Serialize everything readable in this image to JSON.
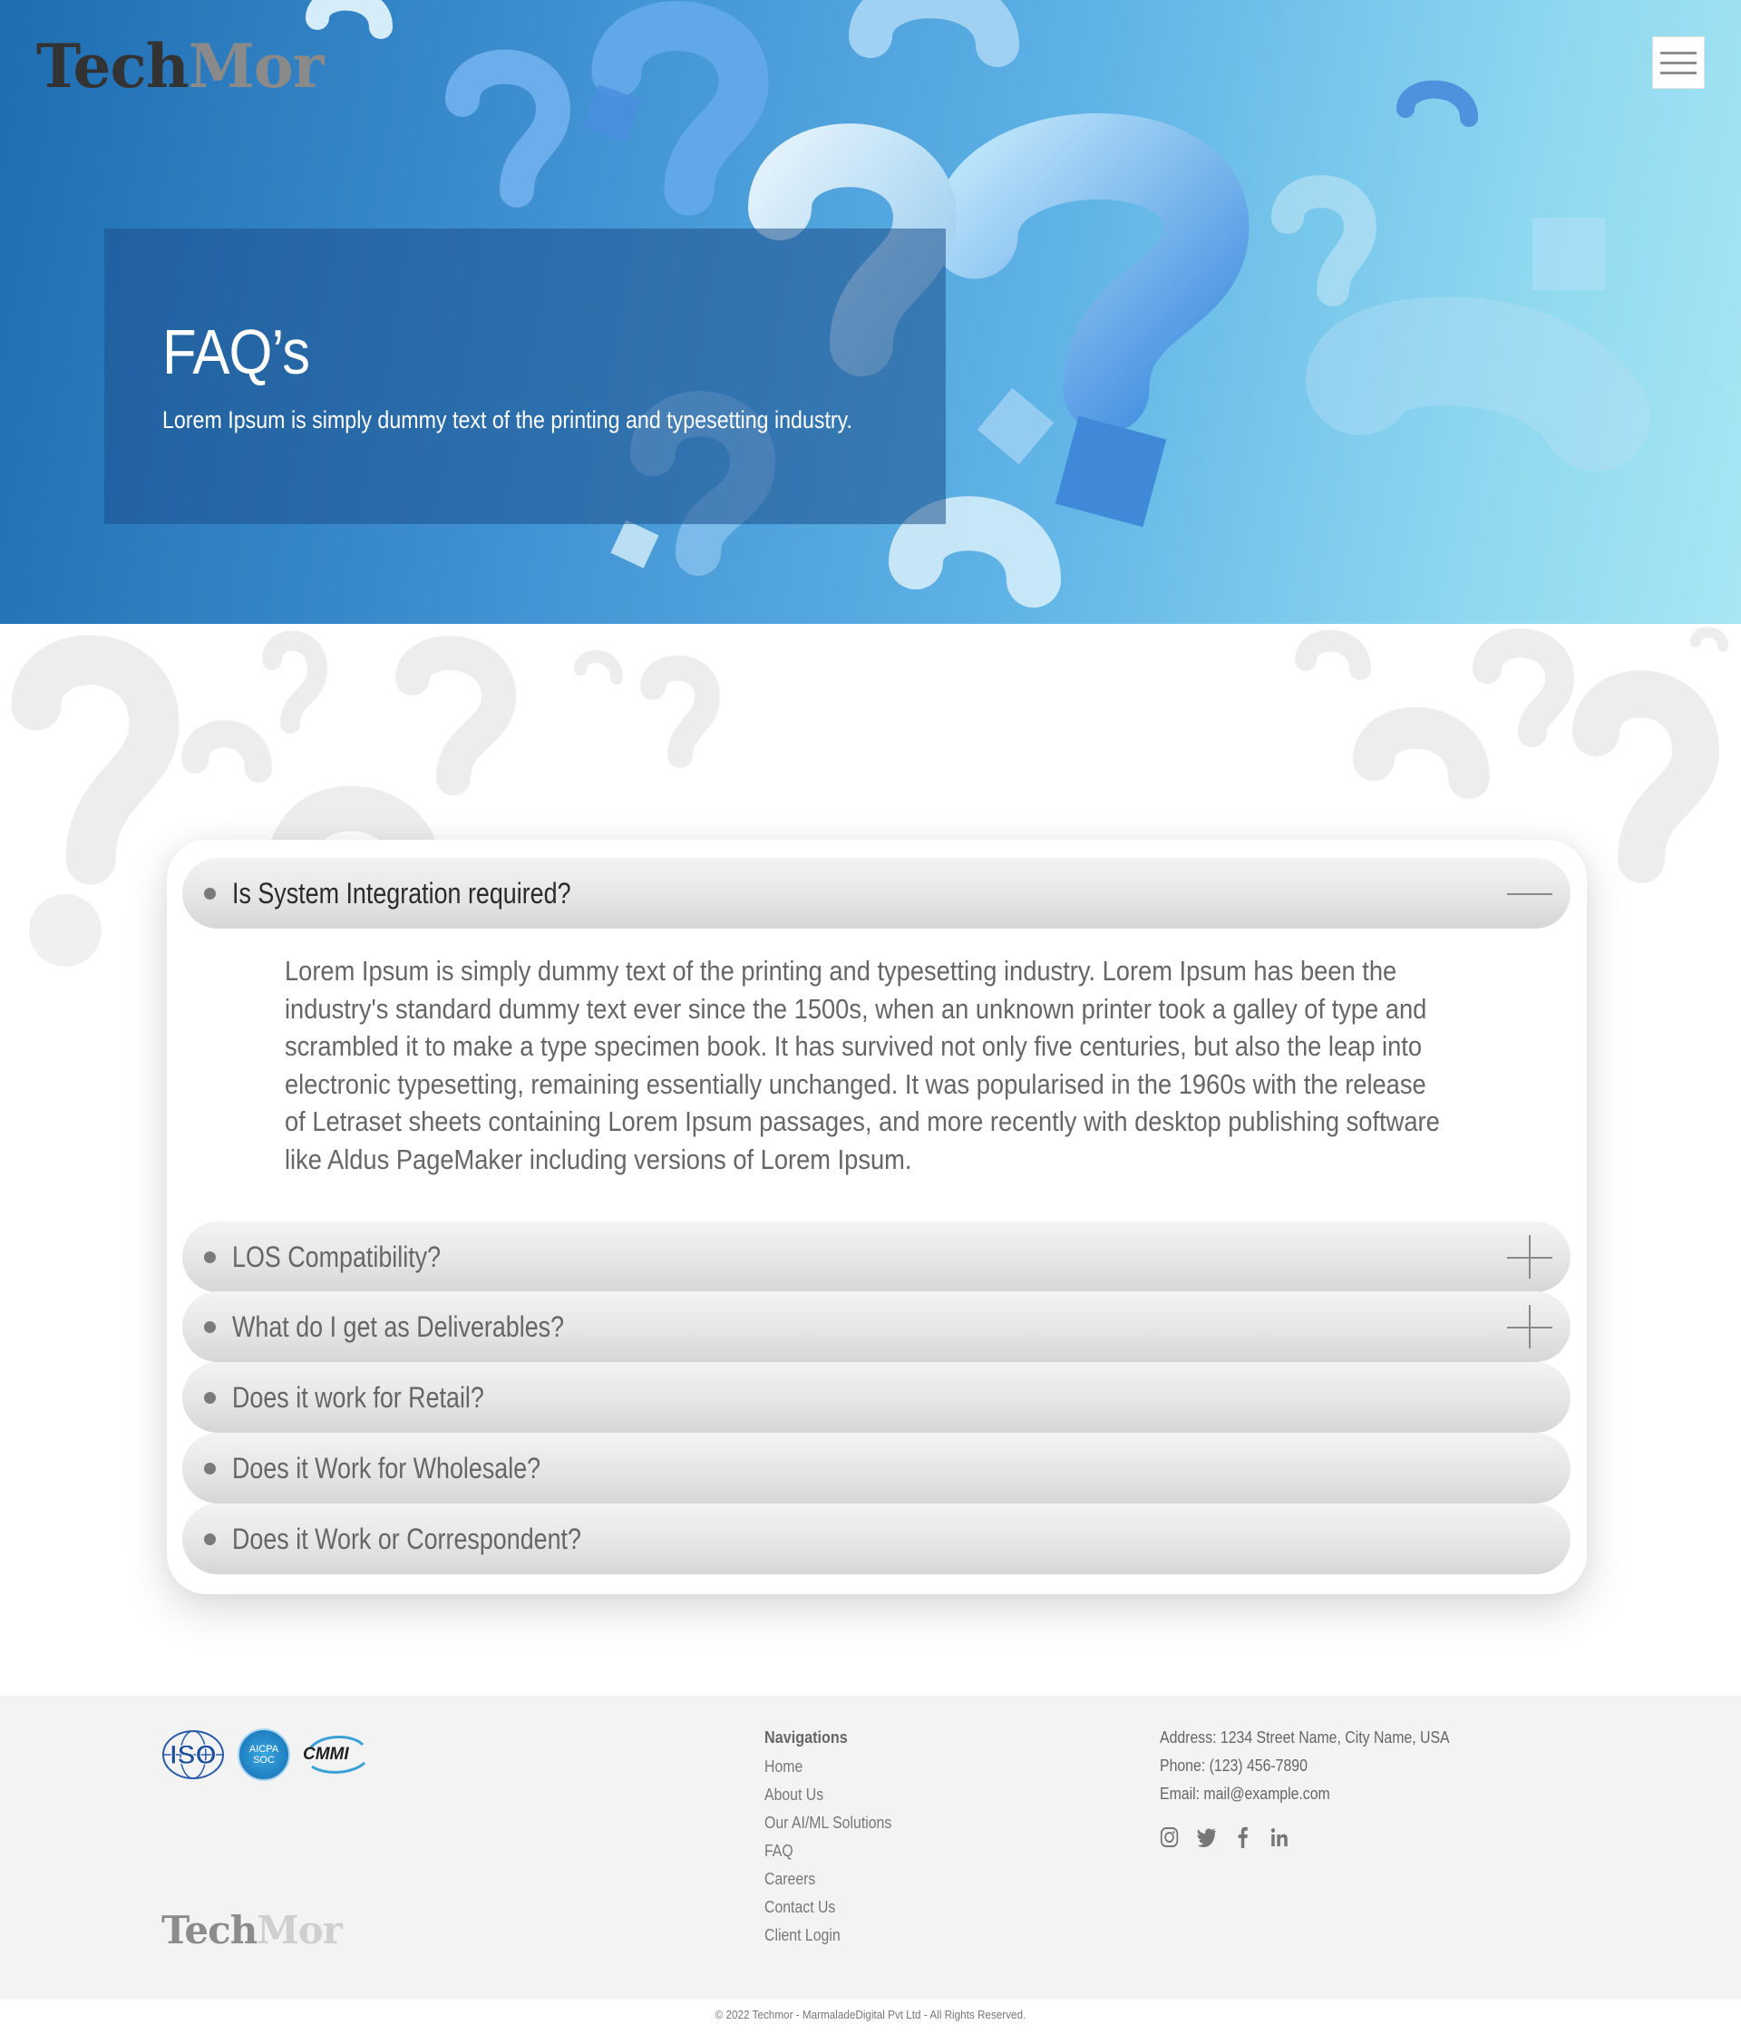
{
  "header": {
    "logo_part1": "Tech",
    "logo_part2": "Mor",
    "menu_icon": "hamburger-icon"
  },
  "hero": {
    "title": "FAQ’s",
    "subtitle": "Lorem Ipsum is simply dummy text of the printing and typesetting industry."
  },
  "faq": {
    "items": [
      {
        "question": "Is System Integration required?",
        "state": "open",
        "answer": "Lorem Ipsum is simply dummy text of the printing and typesetting industry. Lorem Ipsum has been the industry's standard dummy text ever since the 1500s, when an unknown printer took a galley of type and scrambled it to make a type specimen book. It has survived not only five centuries, but also the leap into electronic typesetting, remaining essentially unchanged. It was popularised in the 1960s with the release of Letraset sheets containing Lorem Ipsum passages, and more recently with desktop publishing software like Aldus PageMaker including versions of Lorem Ipsum."
      },
      {
        "question": "LOS Compatibility?",
        "state": "closed"
      },
      {
        "question": "What do I get as Deliverables?",
        "state": "closed"
      },
      {
        "question": "Does it work for Retail?",
        "state": "closed"
      },
      {
        "question": "Does it Work for Wholesale?",
        "state": "closed"
      },
      {
        "question": "Does it Work or Correspondent?",
        "state": "closed"
      }
    ]
  },
  "footer": {
    "badges": {
      "iso": "ISO",
      "aicpa_line1": "AICPA",
      "aicpa_line2": "SOC",
      "cmmi": "CMMI"
    },
    "logo_part1": "Tech",
    "logo_part2": "Mor",
    "nav_heading": "Navigations",
    "nav_links": [
      "Home",
      "About Us",
      "Our AI/ML Solutions",
      "FAQ",
      "Careers",
      "Contact Us",
      "Client Login"
    ],
    "address": "Address: 1234 Street Name, City Name, USA",
    "phone": "Phone: (123) 456-7890",
    "email": "Email: mail@example.com",
    "social_icons": [
      "instagram-icon",
      "twitter-icon",
      "facebook-icon",
      "linkedin-icon"
    ],
    "copyright": "© 2022 Techmor - MarmaladeDigital Pvt Ltd - All Rights Reserved."
  },
  "colors": {
    "hero_blue": "#2f7fc4",
    "accent_light": "#8ed8f0",
    "text_gray": "#666666",
    "footer_bg": "#f3f3f3"
  }
}
